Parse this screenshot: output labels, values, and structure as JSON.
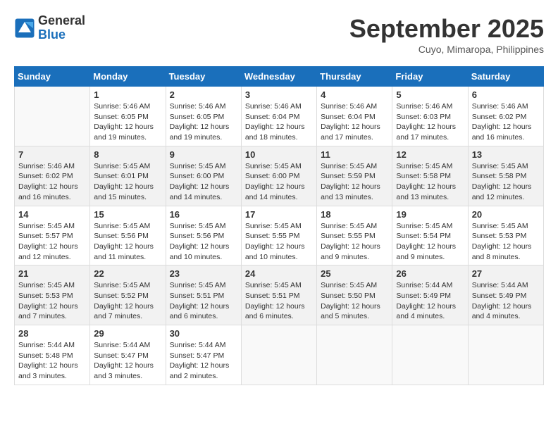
{
  "header": {
    "logo_general": "General",
    "logo_blue": "Blue",
    "month": "September 2025",
    "location": "Cuyo, Mimaropa, Philippines"
  },
  "days_of_week": [
    "Sunday",
    "Monday",
    "Tuesday",
    "Wednesday",
    "Thursday",
    "Friday",
    "Saturday"
  ],
  "weeks": [
    {
      "shaded": false,
      "days": [
        {
          "date": "",
          "info": ""
        },
        {
          "date": "1",
          "info": "Sunrise: 5:46 AM\nSunset: 6:05 PM\nDaylight: 12 hours\nand 19 minutes."
        },
        {
          "date": "2",
          "info": "Sunrise: 5:46 AM\nSunset: 6:05 PM\nDaylight: 12 hours\nand 19 minutes."
        },
        {
          "date": "3",
          "info": "Sunrise: 5:46 AM\nSunset: 6:04 PM\nDaylight: 12 hours\nand 18 minutes."
        },
        {
          "date": "4",
          "info": "Sunrise: 5:46 AM\nSunset: 6:04 PM\nDaylight: 12 hours\nand 17 minutes."
        },
        {
          "date": "5",
          "info": "Sunrise: 5:46 AM\nSunset: 6:03 PM\nDaylight: 12 hours\nand 17 minutes."
        },
        {
          "date": "6",
          "info": "Sunrise: 5:46 AM\nSunset: 6:02 PM\nDaylight: 12 hours\nand 16 minutes."
        }
      ]
    },
    {
      "shaded": true,
      "days": [
        {
          "date": "7",
          "info": "Sunrise: 5:46 AM\nSunset: 6:02 PM\nDaylight: 12 hours\nand 16 minutes."
        },
        {
          "date": "8",
          "info": "Sunrise: 5:45 AM\nSunset: 6:01 PM\nDaylight: 12 hours\nand 15 minutes."
        },
        {
          "date": "9",
          "info": "Sunrise: 5:45 AM\nSunset: 6:00 PM\nDaylight: 12 hours\nand 14 minutes."
        },
        {
          "date": "10",
          "info": "Sunrise: 5:45 AM\nSunset: 6:00 PM\nDaylight: 12 hours\nand 14 minutes."
        },
        {
          "date": "11",
          "info": "Sunrise: 5:45 AM\nSunset: 5:59 PM\nDaylight: 12 hours\nand 13 minutes."
        },
        {
          "date": "12",
          "info": "Sunrise: 5:45 AM\nSunset: 5:58 PM\nDaylight: 12 hours\nand 13 minutes."
        },
        {
          "date": "13",
          "info": "Sunrise: 5:45 AM\nSunset: 5:58 PM\nDaylight: 12 hours\nand 12 minutes."
        }
      ]
    },
    {
      "shaded": false,
      "days": [
        {
          "date": "14",
          "info": "Sunrise: 5:45 AM\nSunset: 5:57 PM\nDaylight: 12 hours\nand 12 minutes."
        },
        {
          "date": "15",
          "info": "Sunrise: 5:45 AM\nSunset: 5:56 PM\nDaylight: 12 hours\nand 11 minutes."
        },
        {
          "date": "16",
          "info": "Sunrise: 5:45 AM\nSunset: 5:56 PM\nDaylight: 12 hours\nand 10 minutes."
        },
        {
          "date": "17",
          "info": "Sunrise: 5:45 AM\nSunset: 5:55 PM\nDaylight: 12 hours\nand 10 minutes."
        },
        {
          "date": "18",
          "info": "Sunrise: 5:45 AM\nSunset: 5:55 PM\nDaylight: 12 hours\nand 9 minutes."
        },
        {
          "date": "19",
          "info": "Sunrise: 5:45 AM\nSunset: 5:54 PM\nDaylight: 12 hours\nand 9 minutes."
        },
        {
          "date": "20",
          "info": "Sunrise: 5:45 AM\nSunset: 5:53 PM\nDaylight: 12 hours\nand 8 minutes."
        }
      ]
    },
    {
      "shaded": true,
      "days": [
        {
          "date": "21",
          "info": "Sunrise: 5:45 AM\nSunset: 5:53 PM\nDaylight: 12 hours\nand 7 minutes."
        },
        {
          "date": "22",
          "info": "Sunrise: 5:45 AM\nSunset: 5:52 PM\nDaylight: 12 hours\nand 7 minutes."
        },
        {
          "date": "23",
          "info": "Sunrise: 5:45 AM\nSunset: 5:51 PM\nDaylight: 12 hours\nand 6 minutes."
        },
        {
          "date": "24",
          "info": "Sunrise: 5:45 AM\nSunset: 5:51 PM\nDaylight: 12 hours\nand 6 minutes."
        },
        {
          "date": "25",
          "info": "Sunrise: 5:45 AM\nSunset: 5:50 PM\nDaylight: 12 hours\nand 5 minutes."
        },
        {
          "date": "26",
          "info": "Sunrise: 5:44 AM\nSunset: 5:49 PM\nDaylight: 12 hours\nand 4 minutes."
        },
        {
          "date": "27",
          "info": "Sunrise: 5:44 AM\nSunset: 5:49 PM\nDaylight: 12 hours\nand 4 minutes."
        }
      ]
    },
    {
      "shaded": false,
      "days": [
        {
          "date": "28",
          "info": "Sunrise: 5:44 AM\nSunset: 5:48 PM\nDaylight: 12 hours\nand 3 minutes."
        },
        {
          "date": "29",
          "info": "Sunrise: 5:44 AM\nSunset: 5:47 PM\nDaylight: 12 hours\nand 3 minutes."
        },
        {
          "date": "30",
          "info": "Sunrise: 5:44 AM\nSunset: 5:47 PM\nDaylight: 12 hours\nand 2 minutes."
        },
        {
          "date": "",
          "info": ""
        },
        {
          "date": "",
          "info": ""
        },
        {
          "date": "",
          "info": ""
        },
        {
          "date": "",
          "info": ""
        }
      ]
    }
  ]
}
